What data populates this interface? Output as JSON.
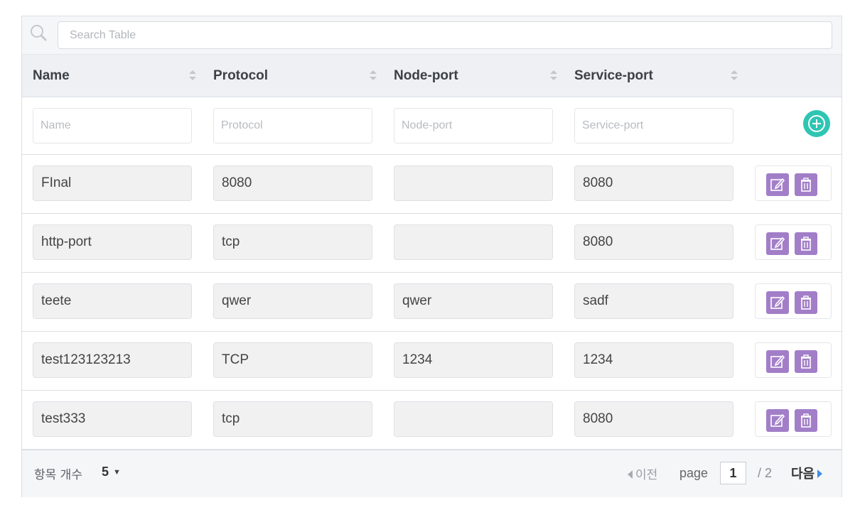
{
  "search": {
    "placeholder": "Search Table"
  },
  "columns": [
    {
      "label": "Name"
    },
    {
      "label": "Protocol"
    },
    {
      "label": "Node-port"
    },
    {
      "label": "Service-port"
    }
  ],
  "new_row": {
    "placeholders": [
      "Name",
      "Protocol",
      "Node-port",
      "Service-port"
    ],
    "add_icon": "plus-circle-icon"
  },
  "rows": [
    {
      "name": "FInal",
      "protocol": "8080",
      "node_port": "",
      "service_port": "8080"
    },
    {
      "name": "http-port",
      "protocol": "tcp",
      "node_port": "",
      "service_port": "8080"
    },
    {
      "name": "teete",
      "protocol": "qwer",
      "node_port": "qwer",
      "service_port": "sadf"
    },
    {
      "name": "test123123213",
      "protocol": "TCP",
      "node_port": "1234",
      "service_port": "1234"
    },
    {
      "name": "test333",
      "protocol": "tcp",
      "node_port": "",
      "service_port": "8080"
    }
  ],
  "row_actions": {
    "edit_icon": "edit-icon",
    "delete_icon": "trash-icon"
  },
  "footer": {
    "items_label": "항목 개수",
    "page_size": "5",
    "prev_label": "이전",
    "page_label": "page",
    "current_page": "1",
    "total_pages": "/ 2",
    "next_label": "다음"
  },
  "colors": {
    "accent_add": "#2fc5b3",
    "action_button": "#a27ec8",
    "next_arrow": "#3d8fe6"
  }
}
